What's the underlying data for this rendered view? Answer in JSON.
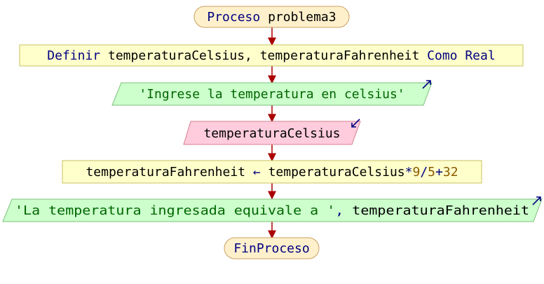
{
  "flowchart": {
    "start": {
      "keyword": "Proceso",
      "name": "problema3"
    },
    "definir": {
      "keyword": "Definir",
      "vars": "temperaturaCelsius, temperaturaFahrenheit",
      "tipo": "Como Real"
    },
    "escribir1": {
      "text": "'Ingrese la temperatura en celsius'"
    },
    "leer": {
      "var": "temperaturaCelsius"
    },
    "asignacion": {
      "target": "temperaturaFahrenheit",
      "arrow": "←",
      "operand": "temperaturaCelsius",
      "op1": "*",
      "num1": "9",
      "op2": "/",
      "num2": "5",
      "op3": "+",
      "num3": "32"
    },
    "escribir2": {
      "text": "'La temperatura ingresada equivale a '",
      "sep": ",",
      "var": "temperaturaFahrenheit"
    },
    "end": {
      "label": "FinProceso"
    }
  },
  "colors": {
    "terminal_fill": "#fff0cc",
    "process_fill": "#ffffcc",
    "output_fill": "#ccffcc",
    "input_fill": "#ffccdd",
    "keyword": "#000080",
    "string": "#006600",
    "number": "#8b5a00",
    "edge": "#aa0000"
  }
}
